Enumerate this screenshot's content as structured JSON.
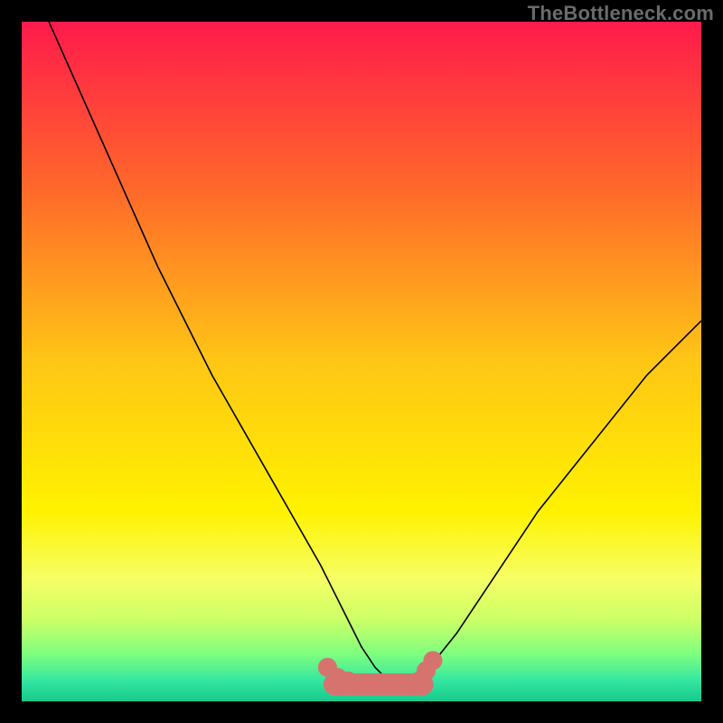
{
  "watermark": "TheBottleneck.com",
  "chart_data": {
    "type": "line",
    "title": "",
    "xlabel": "",
    "ylabel": "",
    "xlim": [
      0,
      100
    ],
    "ylim": [
      0,
      100
    ],
    "grid": false,
    "legend": false,
    "gradient_stops": [
      {
        "offset": 0.0,
        "color": "#ff1a4b"
      },
      {
        "offset": 0.25,
        "color": "#ff6a2a"
      },
      {
        "offset": 0.5,
        "color": "#ffc615"
      },
      {
        "offset": 0.72,
        "color": "#fff200"
      },
      {
        "offset": 0.82,
        "color": "#f6ff66"
      },
      {
        "offset": 0.88,
        "color": "#ccff66"
      },
      {
        "offset": 0.93,
        "color": "#7fff7f"
      },
      {
        "offset": 0.97,
        "color": "#33e6a0"
      },
      {
        "offset": 1.0,
        "color": "#18c98c"
      }
    ],
    "series": [
      {
        "name": "bottleneck-curve",
        "color": "#000000",
        "x": [
          4,
          8,
          12,
          16,
          20,
          24,
          28,
          32,
          36,
          40,
          44,
          46,
          48,
          50,
          52,
          54,
          56,
          58,
          60,
          64,
          68,
          72,
          76,
          80,
          84,
          88,
          92,
          96,
          100
        ],
        "y": [
          100,
          91,
          82,
          73,
          64,
          56,
          48,
          41,
          34,
          27,
          20,
          16,
          12,
          8,
          5,
          3,
          2,
          3,
          5,
          10,
          16,
          22,
          28,
          33,
          38,
          43,
          48,
          52,
          56
        ]
      }
    ],
    "flat_band": {
      "color": "#d6736f",
      "y": 2.5,
      "x_start": 46,
      "x_end": 59,
      "dots_x": [
        45,
        46.5,
        48,
        58.5,
        59.5,
        60.5
      ],
      "dots_y": [
        5,
        3.5,
        3,
        3,
        4.5,
        6
      ]
    }
  }
}
